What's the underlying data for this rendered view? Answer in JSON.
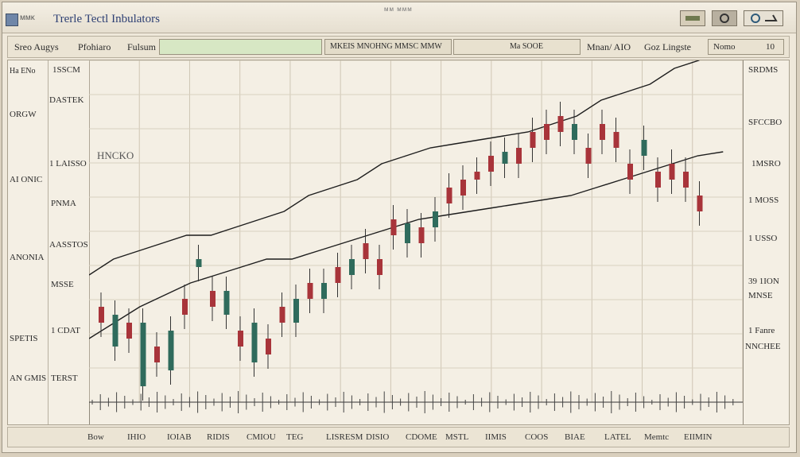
{
  "window": {
    "app_name": "ᴍᴍᴋ",
    "title": "Trerle Tectl Inbulators",
    "center_text": "ᴍᴍ  ᴍᴍᴍ"
  },
  "toolbar": {
    "items": [
      "Sreo Augys",
      "Pfohiaro",
      "Fulsum",
      "MKEIS MNOHNG MMSC MMW",
      "Ma SOOE",
      "Mnan/ AIO",
      "Goz Lingste",
      "Nomo"
    ],
    "zoom_value": "10"
  },
  "left_labels": [
    "Ha ENo",
    "ORGW",
    "AI ONIC",
    "ANONIA",
    "SPETIS",
    "AN GMIS"
  ],
  "axis_labels": [
    "1SSCM",
    "DASTEK",
    "1 LAISSO",
    "PNMA",
    "AASSTOS",
    "MSSE",
    "1 CDAT",
    "TERST"
  ],
  "right_labels": [
    "SRDMS",
    "SFCCBO",
    "1MSRO",
    "1 MOSS",
    "1 USSO",
    "39 1ION",
    "MNSE",
    "1 Fanre",
    "NNCHEE"
  ],
  "chart_label": "HNCKO",
  "bottom": {
    "items": [
      "Bow",
      "IHIO",
      "IOIAB",
      "RIDIS",
      "CMIOU",
      "TEG",
      "LISRESM",
      "DISIO",
      "CDOME",
      "MSTL",
      "IIMIS",
      "COOS",
      "BIAE",
      "LATEL",
      "Memtc",
      "EIIMIN"
    ]
  },
  "chart_data": {
    "type": "candlestick",
    "candles": [
      [
        310,
        330,
        250,
        245,
        335
      ],
      [
        360,
        320,
        280,
        275,
        365
      ],
      [
        330,
        350,
        300,
        295,
        355
      ],
      [
        410,
        330,
        370,
        320,
        415
      ],
      [
        360,
        380,
        330,
        325,
        385
      ],
      [
        390,
        340,
        330,
        325,
        395
      ],
      [
        300,
        320,
        250,
        245,
        325
      ],
      [
        260,
        250,
        240,
        235,
        265
      ],
      [
        290,
        310,
        260,
        255,
        315
      ],
      [
        320,
        290,
        330,
        325,
        300
      ],
      [
        340,
        360,
        300,
        295,
        365
      ],
      [
        380,
        330,
        360,
        355,
        390
      ],
      [
        350,
        370,
        320,
        315,
        375
      ],
      [
        310,
        330,
        250,
        245,
        335
      ],
      [
        330,
        300,
        280,
        275,
        335
      ],
      [
        280,
        300,
        220,
        215,
        305
      ],
      [
        300,
        280,
        270,
        265,
        305
      ],
      [
        260,
        280,
        210,
        205,
        285
      ],
      [
        270,
        250,
        280,
        275,
        255
      ],
      [
        230,
        250,
        215,
        210,
        255
      ],
      [
        250,
        270,
        230,
        225,
        275
      ],
      [
        200,
        220,
        195,
        190,
        225
      ],
      [
        230,
        205,
        190,
        185,
        235
      ],
      [
        210,
        230,
        170,
        165,
        235
      ],
      [
        210,
        190,
        175,
        170,
        215
      ],
      [
        160,
        180,
        140,
        135,
        185
      ],
      [
        150,
        170,
        130,
        125,
        175
      ],
      [
        140,
        150,
        120,
        115,
        155
      ],
      [
        120,
        140,
        100,
        95,
        145
      ],
      [
        130,
        115,
        100,
        95,
        135
      ],
      [
        110,
        130,
        90,
        85,
        135
      ],
      [
        90,
        110,
        80,
        75,
        115
      ],
      [
        80,
        100,
        60,
        55,
        105
      ],
      [
        70,
        90,
        60,
        55,
        95
      ],
      [
        100,
        80,
        90,
        85,
        105
      ],
      [
        110,
        130,
        100,
        95,
        135
      ],
      [
        80,
        100,
        70,
        65,
        105
      ],
      [
        90,
        110,
        80,
        75,
        115
      ],
      [
        130,
        150,
        110,
        105,
        155
      ],
      [
        120,
        100,
        110,
        105,
        125
      ],
      [
        140,
        160,
        130,
        125,
        165
      ],
      [
        130,
        150,
        120,
        115,
        155
      ],
      [
        140,
        160,
        125,
        120,
        165
      ],
      [
        170,
        190,
        150,
        145,
        195
      ]
    ],
    "series": [
      {
        "name": "MA1",
        "values": [
          110,
          130,
          140,
          150,
          160,
          160,
          170,
          180,
          190,
          210,
          220,
          230,
          250,
          260,
          270,
          275,
          280,
          285,
          290,
          300,
          310,
          330,
          340,
          350,
          370,
          380,
          400
        ]
      },
      {
        "name": "MA2",
        "values": [
          60,
          80,
          100,
          115,
          130,
          140,
          150,
          160,
          160,
          170,
          180,
          190,
          200,
          210,
          215,
          220,
          225,
          230,
          235,
          240,
          250,
          260,
          270,
          280,
          290,
          295
        ]
      }
    ]
  }
}
